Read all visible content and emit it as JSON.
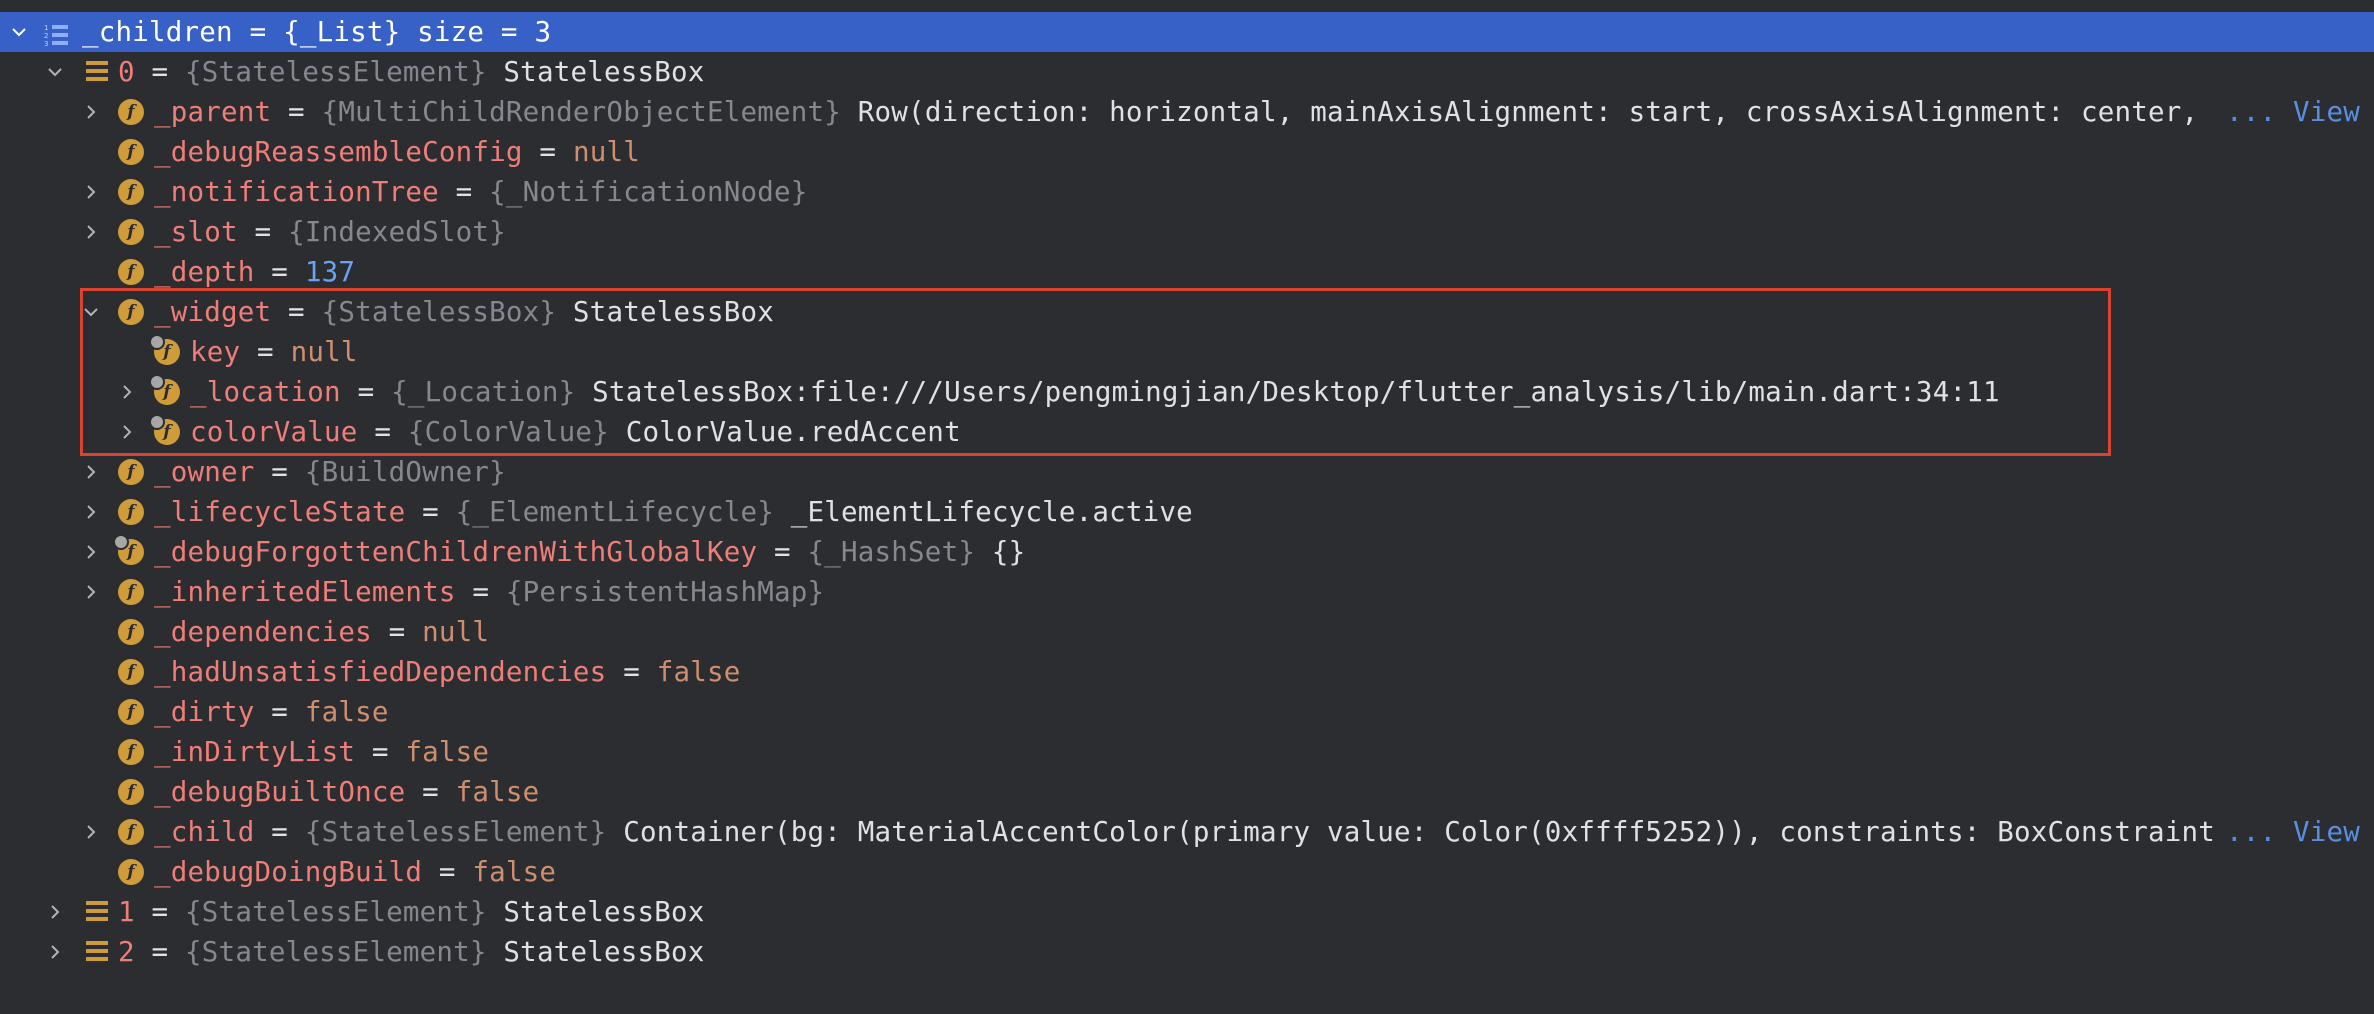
{
  "colors": {
    "background": "#2b2d30",
    "selection": "#3761c7",
    "field_name": "#ef7d78",
    "type": "#85888e",
    "keyword": "#cf8e6d",
    "number": "#6aa1f0",
    "link": "#5a8fe0",
    "field_icon": "#d09c3a",
    "highlight_box": "#d9432f"
  },
  "rows": [
    {
      "name": "_children",
      "sep": " = ",
      "type": "{_List}",
      "value": " size = 3"
    },
    {
      "name": "0",
      "sep": " = ",
      "type": "{StatelessElement}",
      "value": " StatelessBox"
    },
    {
      "name": "_parent",
      "sep": " = ",
      "type": "{MultiChildRenderObjectElement}",
      "value": " Row(direction: horizontal, mainAxisAlignment: start, crossAxisAlignment: center, ",
      "link": "... View"
    },
    {
      "name": "_debugReassembleConfig",
      "sep": " = ",
      "value": "null"
    },
    {
      "name": "_notificationTree",
      "sep": " = ",
      "type": "{_NotificationNode}"
    },
    {
      "name": "_slot",
      "sep": " = ",
      "type": "{IndexedSlot}"
    },
    {
      "name": "_depth",
      "sep": " = ",
      "value": "137"
    },
    {
      "name": "_widget",
      "sep": " = ",
      "type": "{StatelessBox}",
      "value": " StatelessBox"
    },
    {
      "name": "key",
      "sep": " = ",
      "value": "null"
    },
    {
      "name": "_location",
      "sep": " = ",
      "type": "{_Location}",
      "value": " StatelessBox:file:///Users/pengmingjian/Desktop/flutter_analysis/lib/main.dart:34:11"
    },
    {
      "name": "colorValue",
      "sep": " = ",
      "type": "{ColorValue}",
      "value": " ColorValue.redAccent"
    },
    {
      "name": "_owner",
      "sep": " = ",
      "type": "{BuildOwner}"
    },
    {
      "name": "_lifecycleState",
      "sep": " = ",
      "type": "{_ElementLifecycle}",
      "value": " _ElementLifecycle.active"
    },
    {
      "name": "_debugForgottenChildrenWithGlobalKey",
      "sep": " = ",
      "type": "{_HashSet}",
      "value": " {}"
    },
    {
      "name": "_inheritedElements",
      "sep": " = ",
      "type": "{PersistentHashMap}"
    },
    {
      "name": "_dependencies",
      "sep": " = ",
      "value": "null"
    },
    {
      "name": "_hadUnsatisfiedDependencies",
      "sep": " = ",
      "value": "false"
    },
    {
      "name": "_dirty",
      "sep": " = ",
      "value": "false"
    },
    {
      "name": "_inDirtyList",
      "sep": " = ",
      "value": "false"
    },
    {
      "name": "_debugBuiltOnce",
      "sep": " = ",
      "value": "false"
    },
    {
      "name": "_child",
      "sep": " = ",
      "type": "{StatelessElement}",
      "value": " Container(bg: MaterialAccentColor(primary value: Color(0xffff5252)), constraints: BoxConstraint",
      "link": "... View"
    },
    {
      "name": "_debugDoingBuild",
      "sep": " = ",
      "value": "false"
    },
    {
      "name": "1",
      "sep": " = ",
      "type": "{StatelessElement}",
      "value": " StatelessBox"
    },
    {
      "name": "2",
      "sep": " = ",
      "type": "{StatelessElement}",
      "value": " StatelessBox"
    }
  ]
}
